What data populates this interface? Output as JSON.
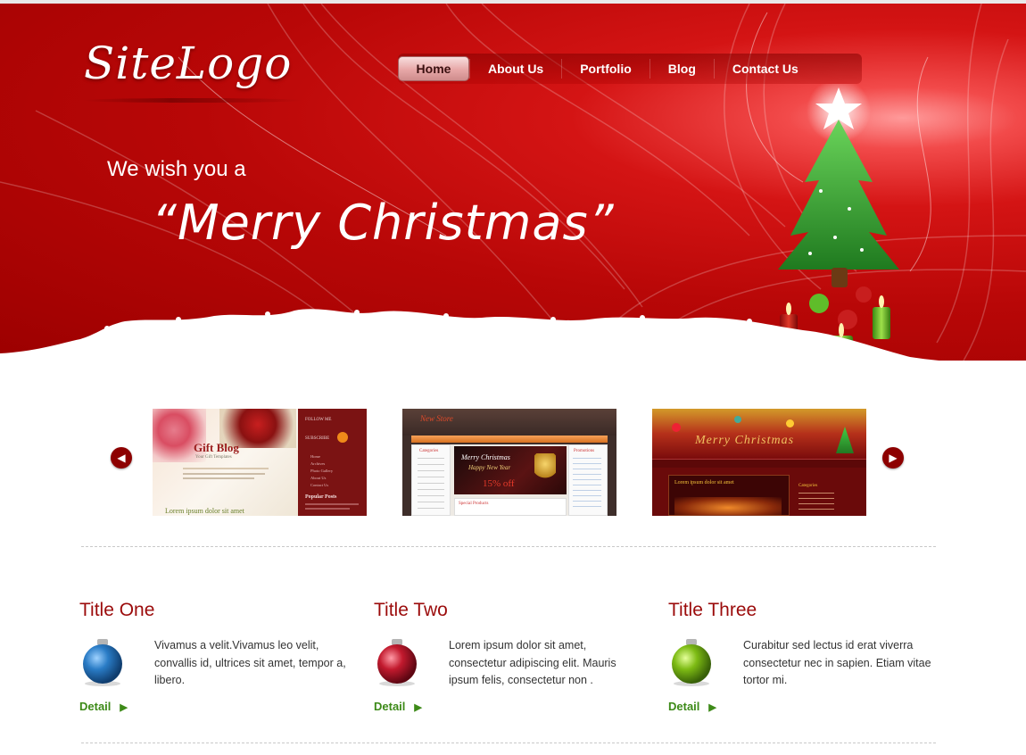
{
  "header": {
    "logo": "SiteLogo",
    "nav": [
      {
        "label": "Home",
        "active": true
      },
      {
        "label": "About Us",
        "active": false
      },
      {
        "label": "Portfolio",
        "active": false
      },
      {
        "label": "Blog",
        "active": false
      },
      {
        "label": "Contact Us",
        "active": false
      }
    ]
  },
  "hero": {
    "line1": "We wish you a",
    "line2": "“Merry Christmas”"
  },
  "slider": {
    "prev_icon": "chevron-left-icon",
    "next_icon": "chevron-right-icon",
    "thumbs": [
      {
        "title": "Gift Blog",
        "subtitle": "Your Gift Templates",
        "follow": "FOLLOW ME",
        "subscribe": "SUBSCRIBE",
        "popular": "Popular Posts",
        "menu": [
          "Home",
          "Archives",
          "Photo Gallery",
          "About Us",
          "Contact Us"
        ],
        "caption": "Lorem ipsum dolor sit amet"
      },
      {
        "store": "New Store",
        "categories": "Categories",
        "promotions": "Promotions",
        "banner_line1": "Merry Christmas",
        "banner_line2": "Happy New Year",
        "discount": "15% off",
        "special": "Special Products"
      },
      {
        "title": "Merry Christmas",
        "post_title": "Lorem ipsum dolor sit amet",
        "categories": "Categories"
      }
    ]
  },
  "columns": [
    {
      "title": "Title One",
      "text": "Vivamus a velit.Vivamus leo velit, convallis id, ultrices sit amet, tempor a, libero.",
      "detail": "Detail",
      "ball_color": "#2a7cc6"
    },
    {
      "title": "Title Two",
      "text": "Lorem ipsum dolor sit amet, consectetur adipiscing elit. Mauris ipsum felis, consectetur non .",
      "detail": "Detail",
      "ball_color": "#c21a2e"
    },
    {
      "title": "Title Three",
      "text": "Curabitur sed lectus id erat viverra consectetur nec in sapien. Etiam vitae tortor mi.",
      "detail": "Detail",
      "ball_color": "#7dbb14"
    }
  ],
  "colors": {
    "hero_red": "#b80707",
    "title_red": "#9b0b0b",
    "detail_green": "#3d8a18"
  }
}
